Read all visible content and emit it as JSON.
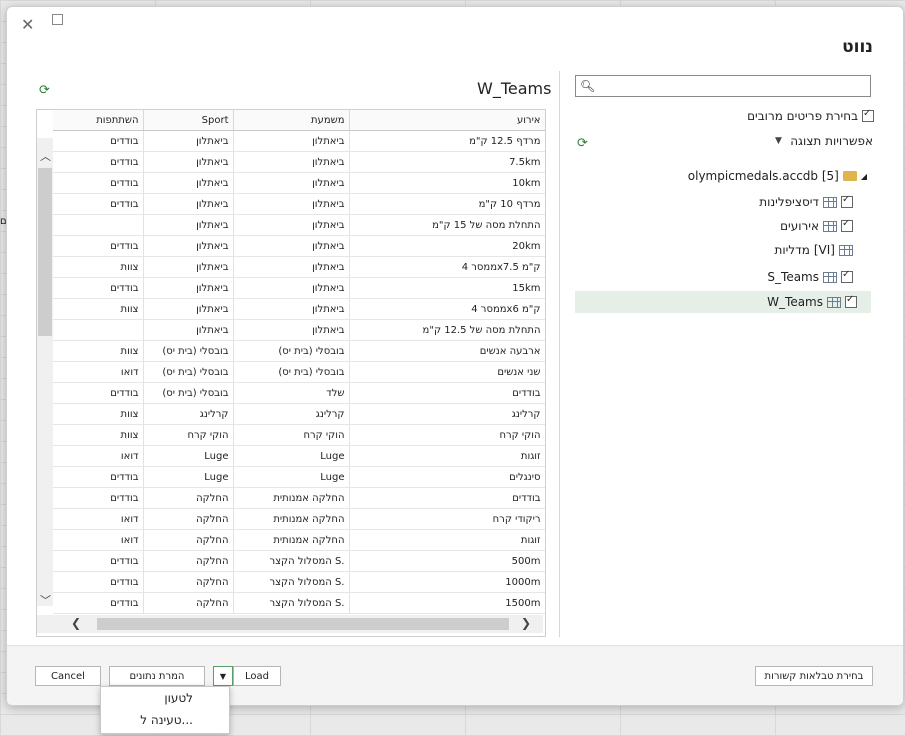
{
  "background": {
    "side_text": "בודדים"
  },
  "dialog": {
    "title": "נווט",
    "search": {
      "value": "",
      "placeholder": ""
    },
    "multi_select_label": "בחירת פריטים מרובים",
    "view_options_label": "אפשרויות תצוגה",
    "tree": {
      "root": "olympicmedals.accdb [5]",
      "items": [
        {
          "label": "דיסציפלינות",
          "checked": true
        },
        {
          "label": "אירועים",
          "checked": true
        },
        {
          "label": "מדליות",
          "prefix": "[VI]",
          "checked": false
        },
        {
          "label": "S_Teams",
          "checked": true
        },
        {
          "label": "W_Teams",
          "checked": true,
          "selected": true
        }
      ]
    },
    "preview": {
      "title": "W_Teams",
      "columns": [
        "אירוע",
        "משמעת",
        "Sport",
        "השתתפות"
      ],
      "rows": [
        [
          "מרדף 12.5 ק\"מ",
          "ביאתלון",
          "ביאתלון",
          "בודדים"
        ],
        [
          "7.5km",
          "ביאתלון",
          "ביאתלון",
          "בודדים"
        ],
        [
          "10km",
          "ביאתלון",
          "ביאתלון",
          "בודדים"
        ],
        [
          "מרדף 10 ק\"מ",
          "ביאתלון",
          "ביאתלון",
          "בודדים"
        ],
        [
          "התחלת מסה של 15 ק\"מ",
          "ביאתלון",
          "ביאתלון",
          ""
        ],
        [
          "20km",
          "ביאתלון",
          "ביאתלון",
          "בודדים"
        ],
        [
          "ממסר 4x7.5 ק\"מ",
          "ביאתלון",
          "ביאתלון",
          "צוות"
        ],
        [
          "15km",
          "ביאתלון",
          "ביאתלון",
          "בודדים"
        ],
        [
          "ממסר 4x6 ק\"מ",
          "ביאתלון",
          "ביאתלון",
          "צוות"
        ],
        [
          "התחלת מסה של 12.5 ק\"מ",
          "ביאתלון",
          "ביאתלון",
          ""
        ],
        [
          "ארבעה אנשים",
          "בובסלי (בית יס)",
          "בובסלי (בית יס)",
          "צוות"
        ],
        [
          "שני אנשים",
          "בובסלי (בית יס)",
          "בובסלי (בית יס)",
          "דואו"
        ],
        [
          "בודדים",
          "שלד",
          "בובסלי (בית יס)",
          "בודדים"
        ],
        [
          "קרלינג",
          "קרלינג",
          "קרלינג",
          "צוות"
        ],
        [
          "הוקי קרח",
          "הוקי קרח",
          "הוקי קרח",
          "צוות"
        ],
        [
          "זוגות",
          "Luge",
          "Luge",
          "דואו"
        ],
        [
          "סינגלים",
          "Luge",
          "Luge",
          "בודדים"
        ],
        [
          "בודדים",
          "החלקה אמנותית",
          "החלקה",
          "בודדים"
        ],
        [
          "ריקודי קרח",
          "החלקה אמנותית",
          "החלקה",
          "דואו"
        ],
        [
          "זוגות",
          "החלקה אמנותית",
          "החלקה",
          "דואו"
        ],
        [
          "500m",
          "המסלול הקצר S.",
          "החלקה",
          "בודדים"
        ],
        [
          "1000m",
          "המסלול הקצר S.",
          "החלקה",
          "בודדים"
        ],
        [
          "1500m",
          "המסלול הקצר S.",
          "החלקה",
          "בודדים"
        ]
      ]
    },
    "footer": {
      "related_tables_label": "בחירת טבלאות קשורות",
      "load_label": "Load",
      "transform_label": "המרת נתונים",
      "cancel_label": "Cancel",
      "menu": [
        "לטעון",
        "טעינה ל..."
      ]
    }
  }
}
